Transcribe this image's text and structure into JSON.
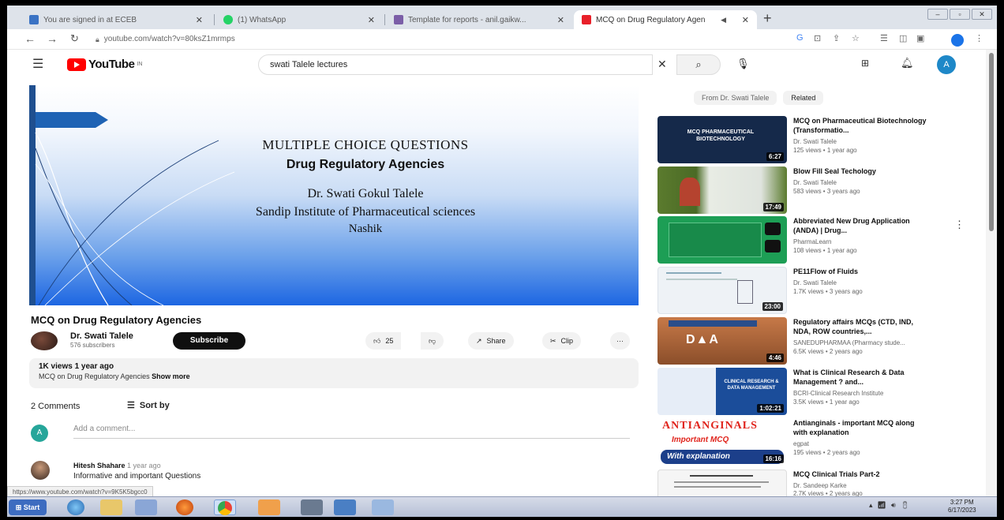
{
  "browser": {
    "tabs": [
      {
        "label": "You are signed in at ECEB",
        "favicon_color": "#3b73c4"
      },
      {
        "label": "(1) WhatsApp",
        "favicon_color": "#25d366"
      },
      {
        "label": "Template for reports - anil.gaikw...",
        "favicon_color": "#7b5ea7"
      },
      {
        "label": "MCQ on Drug Regulatory Agen",
        "favicon_color": "#e8202a"
      }
    ],
    "url": "youtube.com/watch?v=80ksZ1mrmps"
  },
  "youtube": {
    "logo_text": "YouTube",
    "logo_sup": "IN",
    "search_value": "swati Talele lectures",
    "avatar_letter": "A"
  },
  "slide": {
    "line1": "MULTIPLE CHOICE QUESTIONS",
    "line2": "Drug Regulatory Agencies",
    "line3": "Dr. Swati Gokul Talele",
    "line4": "Sandip Institute of Pharmaceutical sciences",
    "line5": "Nashik"
  },
  "video": {
    "title": "MCQ on Drug Regulatory Agencies",
    "channel": "Dr. Swati Talele",
    "subscribers": "576 subscribers",
    "subscribe_label": "Subscribe",
    "likes": "25",
    "share_label": "Share",
    "clip_label": "Clip",
    "more_label": "···",
    "views_age": "1K views  1 year ago",
    "description": "MCQ on Drug Regulatory Agencies",
    "show_more": "Show more"
  },
  "comments": {
    "count_label": "2 Comments",
    "sort_label": "Sort by",
    "my_avatar": "A",
    "add_placeholder": "Add a comment...",
    "items": [
      {
        "author": "Hitesh Shahare",
        "age": "1 year ago",
        "text": "Informative and important Questions"
      }
    ]
  },
  "sidebar": {
    "chips": [
      "From Dr. Swati Talele",
      "Related"
    ],
    "recommendations": [
      {
        "title": "MCQ on Pharmaceutical Biotechnology (Transformatio...",
        "channel": "Dr. Swati Talele",
        "meta": "125 views • 1 year ago",
        "duration": "6:27",
        "thumb_text": "MCQ PHARMACEUTICAL BIOTECHNOLOGY",
        "bg": "#15294a"
      },
      {
        "title": "Blow Fill Seal Techology",
        "channel": "Dr. Swati Talele",
        "meta": "583 views • 3 years ago",
        "duration": "17:49",
        "thumb_text": "",
        "bg": "#5b7b2e"
      },
      {
        "title": "Abbreviated New Drug Application (ANDA) | Drug...",
        "channel": "PharmaLearn",
        "meta": "108 views • 1 year ago",
        "duration": "",
        "thumb_text": "",
        "bg": "#1d9e55"
      },
      {
        "title": "PE11Flow of Fluids",
        "channel": "Dr. Swati Talele",
        "meta": "1.7K views • 3 years ago",
        "duration": "23:00",
        "thumb_text": "",
        "bg": "#e8eef5"
      },
      {
        "title": "Regulatory affairs MCQs (CTD, IND, NDA, ROW countries,...",
        "channel": "SANEDUPHARMAA (Pharmacy stude...",
        "meta": "6.5K views • 2 years ago",
        "duration": "4:46",
        "thumb_text": "D▲A",
        "bg": "#b5653a"
      },
      {
        "title": "What is Clinical Research & Data Management ? and...",
        "channel": "BCRI-Clinical Research Institute",
        "meta": "3.5K views • 1 year ago",
        "duration": "1:02:21",
        "thumb_text": "CLINICAL RESEARCH & DATA MANAGEMENT",
        "bg": "#1b4d9a"
      },
      {
        "title": "Antianginals - important MCQ along with explanation",
        "channel": "egpat",
        "meta": "195 views • 2 years ago",
        "duration": "16:16",
        "thumb_text": "ANTIANGINALS",
        "bg": "#ffffff"
      },
      {
        "title": "MCQ Clinical Trials Part-2",
        "channel": "Dr. Sandeep Karke",
        "meta": "2.7K views • 2 years ago",
        "duration": "",
        "thumb_text": "",
        "bg": "#f5f5f5"
      }
    ]
  },
  "status_url": "https://www.youtube.com/watch?v=9K5K5bgcc0",
  "taskbar": {
    "start_label": "Start",
    "time": "3:27 PM",
    "date": "6/17/2023"
  },
  "colors": {
    "accent_red": "#ff0000",
    "subscribe_bg": "#0f0f0f",
    "link_blue": "#1a73e8"
  }
}
